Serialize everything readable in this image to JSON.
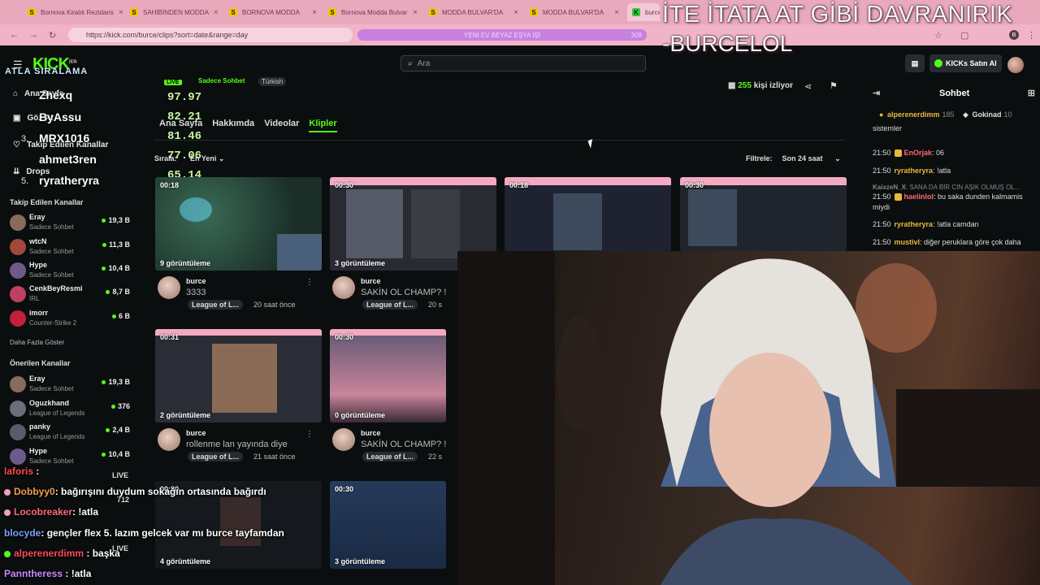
{
  "browser": {
    "tabs": [
      {
        "label": "Bornova Kiralık Rezidans",
        "fav": "S"
      },
      {
        "label": "SAHİBİNDEN MODDA",
        "fav": "S"
      },
      {
        "label": "BORNOVA MODDA",
        "fav": "S"
      },
      {
        "label": "Bornova Modda Bulvar",
        "fav": "S"
      },
      {
        "label": "MODDA BULVAR'DA",
        "fav": "S"
      },
      {
        "label": "MODDA BULVAR'DA",
        "fav": "S"
      },
      {
        "label": "burce",
        "fav": "K"
      }
    ],
    "url": "https://kick.com/burce/clips?sort=date&range=day",
    "banner": "YENİ EV BEYAZ EŞYA İŞİ",
    "banner_count": "308"
  },
  "overlay": {
    "title": "İTE İTATA AT GİBİ DAVRANIRIK",
    "subtitle": "-BURCELOL"
  },
  "topbar": {
    "logo": "KICK",
    "logo_sup": "BETA",
    "search_placeholder": "Ara",
    "buy_kicks": "KICKs Satın Al"
  },
  "sidebar": {
    "nav": [
      {
        "label": "Ana Sayfa",
        "icon": "home-icon"
      },
      {
        "label": "Göz At",
        "icon": "browse-icon"
      },
      {
        "label": "Takip Edilen Kanallar",
        "icon": "heart-icon"
      },
      {
        "label": "Drops",
        "icon": "drops-icon"
      }
    ],
    "followed_title": "Takip Edilen Kanallar",
    "followed": [
      {
        "name": "Eray",
        "game": "Sadece Sohbet",
        "viewers": "19,3 B",
        "color": "#8a6a5a"
      },
      {
        "name": "wtcN",
        "game": "Sadece Sohbet",
        "viewers": "11,3 B",
        "color": "#a0493a"
      },
      {
        "name": "Hype",
        "game": "Sadece Sohbet",
        "viewers": "10,4 B",
        "color": "#6d5a8a"
      },
      {
        "name": "CenkBeyResmi",
        "game": "IRL",
        "viewers": "8,7 B",
        "color": "#c04060"
      },
      {
        "name": "imorr",
        "game": "Counter-Strike 2",
        "viewers": "6 B",
        "color": "#c0203a"
      }
    ],
    "show_more": "Daha Fazla Göster",
    "recommended_title": "Önerilen Kanallar",
    "recommended": [
      {
        "name": "Eray",
        "game": "Sadece Sohbet",
        "viewers": "19,3 B",
        "color": "#8a6a5a"
      },
      {
        "name": "Oguzkhand",
        "game": "League of Legends",
        "viewers": "376",
        "color": "#6a6f7a"
      },
      {
        "name": "panky",
        "game": "League of Legends",
        "viewers": "2,4 B",
        "color": "#5a5a6a"
      },
      {
        "name": "Hype",
        "game": "Sadece Sohbet",
        "viewers": "10,4 B",
        "color": "#6d5a8a"
      }
    ],
    "live_label": "LIVE",
    "partial_views": [
      "712",
      "LIVE"
    ]
  },
  "leaderboard": {
    "title": "ATLA SIRALAMA",
    "entries": [
      {
        "rank": "1.",
        "name": "Zhexq",
        "score": "97.97"
      },
      {
        "rank": "2.",
        "name": "ByAssu",
        "score": "82.21"
      },
      {
        "rank": "3.",
        "name": "MRX1016",
        "score": "81.46"
      },
      {
        "rank": "4.",
        "name": "ahmet3ren",
        "score": "77.06"
      },
      {
        "rank": "5.",
        "name": "ryratheryra",
        "score": "65.14"
      }
    ]
  },
  "channel": {
    "live": "LIVE",
    "category": "Sadece Sohbet",
    "language": "Türkish",
    "viewers_count": "255",
    "viewers_label": "kişi izliyor",
    "tabs": [
      "Ana Sayfa",
      "Hakkımda",
      "Videolar",
      "Klipler"
    ],
    "active_tab": "Klipler",
    "sort_label": "Sırala:",
    "sort_value": "En Yeni",
    "filter_label": "Filtrele:",
    "filter_value": "Son 24 saat"
  },
  "clips": [
    {
      "duration": "00:18",
      "views": "9 görüntüleme",
      "user": "burce",
      "title": "3333",
      "tag": "League of L...",
      "time": "20 saat önce",
      "thumb": "lol"
    },
    {
      "duration": "00:30",
      "views": "3 görüntüleme",
      "user": "burce",
      "title": "SAKİN OL CHAMP? !",
      "tag": "League of L...",
      "time": "20 s",
      "thumb": "cam"
    },
    {
      "duration": "00:18",
      "views": "",
      "user": "",
      "title": "",
      "tag": "",
      "time": "",
      "thumb": "dark"
    },
    {
      "duration": "00:30",
      "views": "",
      "user": "",
      "title": "",
      "tag": "",
      "time": "",
      "thumb": "desk"
    },
    {
      "duration": "00:31",
      "views": "2 görüntüleme",
      "user": "burce",
      "title": "rollenme lan yayında diye",
      "tag": "League of L...",
      "time": "21 saat önce",
      "thumb": "face"
    },
    {
      "duration": "00:30",
      "views": "0 görüntüleme",
      "user": "burce",
      "title": "SAKİN OL CHAMP? !",
      "tag": "League of L...",
      "time": "22 s",
      "thumb": "sunset"
    },
    {
      "duration": "00:30",
      "views": "4 görüntüleme",
      "user": "",
      "title": "",
      "tag": "",
      "time": "",
      "thumb": "dark"
    },
    {
      "duration": "00:30",
      "views": "3 görüntüleme",
      "user": "",
      "title": "",
      "tag": "",
      "time": "",
      "thumb": "blue"
    }
  ],
  "chat": {
    "title": "Sohbet",
    "pins": [
      {
        "name": "alperenerdimm",
        "count": "185"
      },
      {
        "name": "Gokinad",
        "count": "10"
      }
    ],
    "messages": [
      {
        "time": "",
        "user": "",
        "text": "sistemler",
        "color": "#ddd"
      },
      {
        "time": "21:50",
        "user": "EnOrjak",
        "text": ": 06",
        "color": "#ff6b6b"
      },
      {
        "time": "21:50",
        "user": "ryratheryra",
        "text": ": !atla",
        "color": "#e8b93a"
      },
      {
        "time": "",
        "user": "KaixzeN_X",
        "text": ": SANA DA BİR CİN AŞIK OLMUŞ OL...",
        "color": "#888"
      },
      {
        "time": "21:50",
        "user": "haelinlol",
        "text": ": bu saka dunden kalmamis miydi",
        "color": "#ff6b6b"
      },
      {
        "time": "21:50",
        "user": "ryratheryra",
        "text": ": !atla camdan",
        "color": "#e8b93a"
      },
      {
        "time": "21:50",
        "user": "mustivl",
        "text": ": diğer peruklara göre çok daha",
        "color": "#e8b93a"
      }
    ]
  },
  "stream_chat": [
    {
      "user": "laforis",
      "text": " :",
      "color": "#ff4a4a"
    },
    {
      "user": "Dobbyy0",
      "text": ": bağırışını duydum sokağın ortasında bağırdı",
      "color": "#f0a050"
    },
    {
      "user": "Locobreaker",
      "text": ": !atla",
      "color": "#ff6a7a"
    },
    {
      "user": "blocyde",
      "text": ": gençler flex 5. lazım gelcek var mı burce tayfamdan",
      "color": "#7aa0ff"
    },
    {
      "user": "alperenerdimm",
      "text": " : başka",
      "color": "#ff4a5a"
    },
    {
      "user": "Panntheress",
      "text": " : !atla",
      "color": "#c98aff"
    }
  ]
}
